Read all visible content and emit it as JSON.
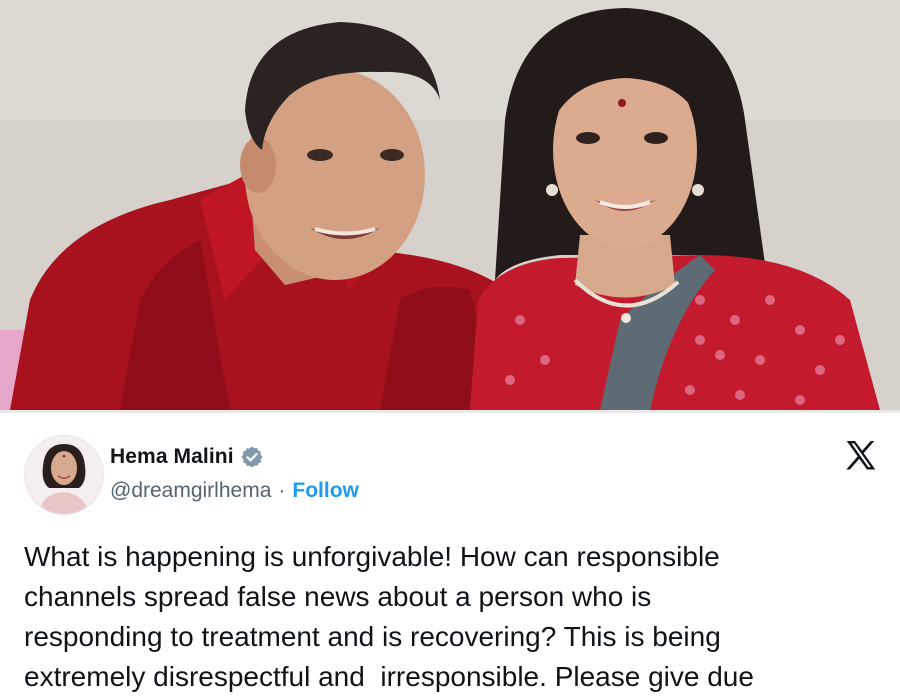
{
  "photo": {
    "description_icon": "couple-photo"
  },
  "tweet": {
    "display_name": "Hema Malini",
    "verified": true,
    "handle": "@dreamgirlhema",
    "separator": "·",
    "follow_label": "Follow",
    "platform_icon": "x-logo-icon",
    "text": "What is happening is unforgivable! How can responsible\nchannels spread false news about a person who is\nresponding to treatment and is recovering? This is being\nextremely disrespectful and  irresponsible. Please give due"
  },
  "colors": {
    "follow": "#1d9bf0",
    "verified_badge": "#829aab",
    "text": "#0f1419",
    "secondary": "#536471"
  }
}
